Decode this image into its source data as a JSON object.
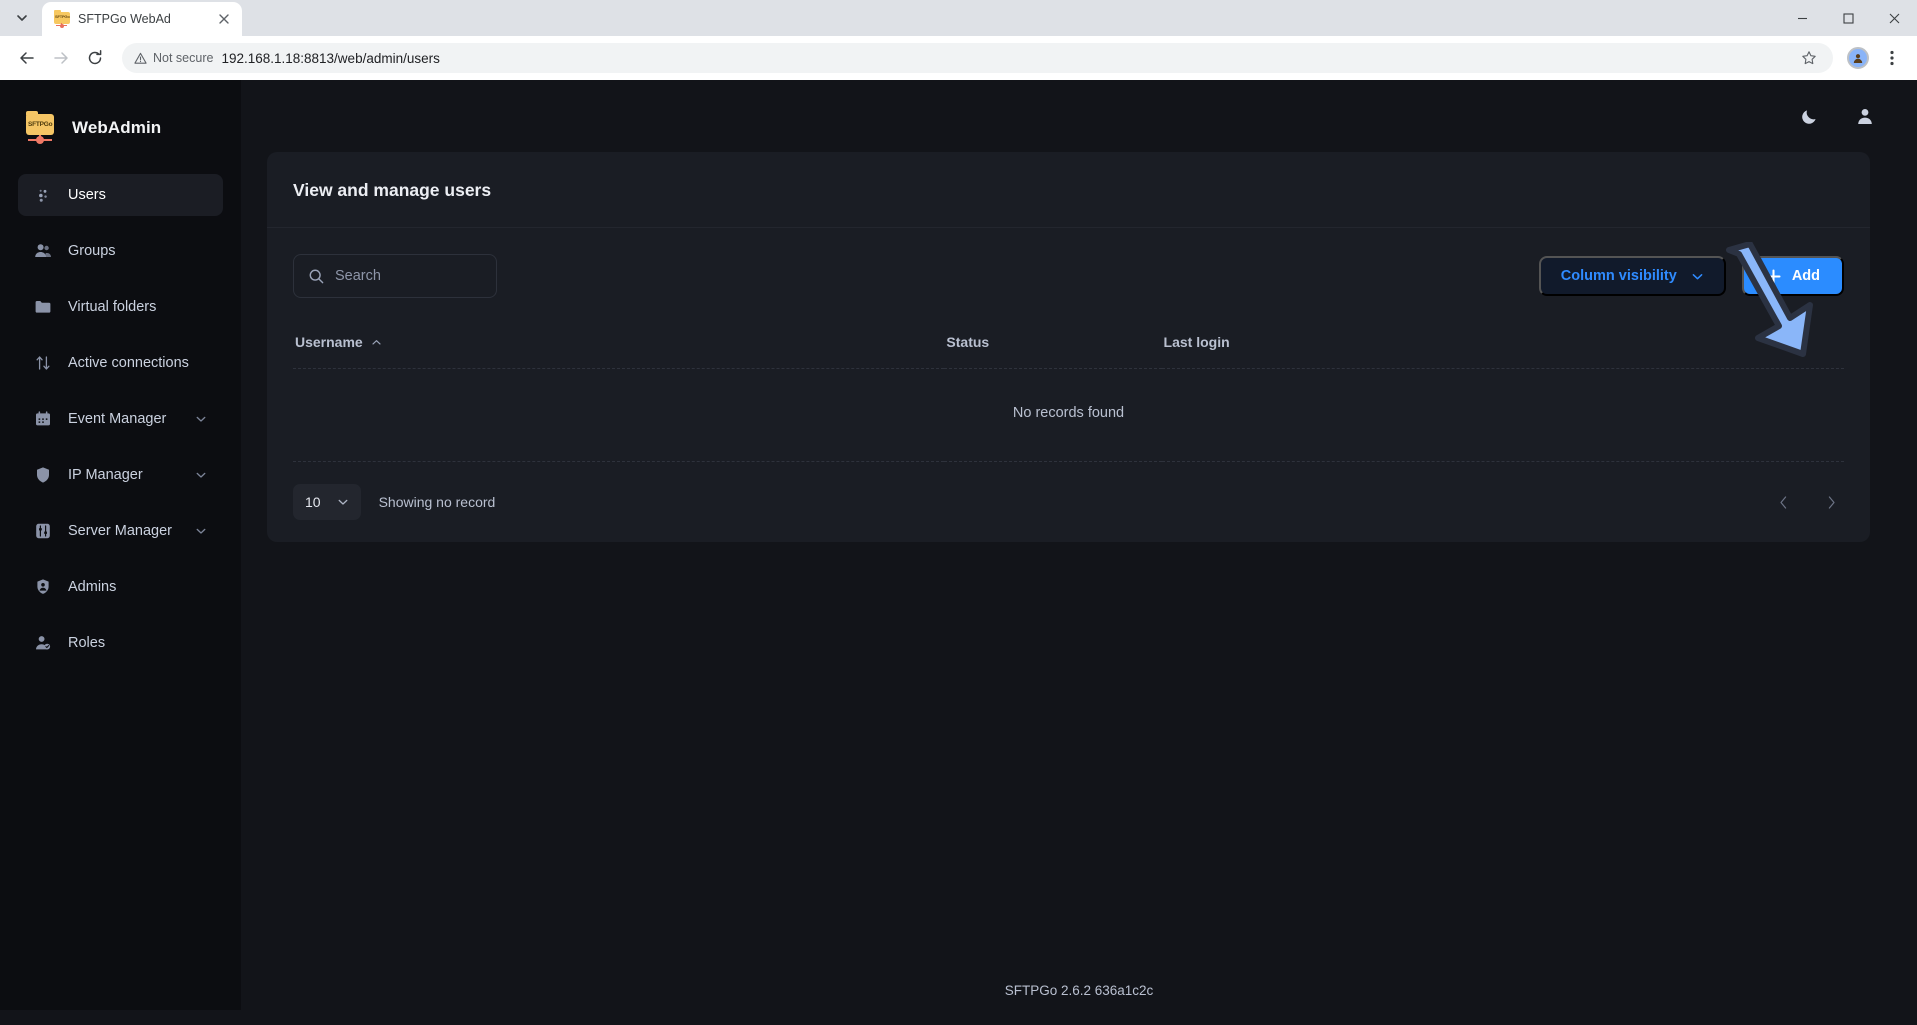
{
  "browser": {
    "tab": {
      "title": "SFTPGo WebAd",
      "favicon_label": "SFTPGo",
      "close_icon": "close-icon"
    },
    "tab_list_icon": "chevron-down-icon",
    "back_icon": "arrow-left-icon",
    "forward_icon": "arrow-right-icon",
    "reload_icon": "reload-icon",
    "security_label": "Not secure",
    "security_icon": "warning-triangle-icon",
    "url": "192.168.1.18:8813/web/admin/users",
    "bookmark_icon": "star-icon",
    "profile_icon": "avatar-icon",
    "menu_icon": "kebab-menu-icon",
    "window_minimize": "—",
    "window_maximize": "❐",
    "window_close": "✕"
  },
  "sidebar": {
    "brand": "WebAdmin",
    "logo_text": "SFTPGo",
    "items": [
      {
        "label": "Users",
        "icon": "users-icon",
        "active": true,
        "expandable": false
      },
      {
        "label": "Groups",
        "icon": "groups-icon",
        "active": false,
        "expandable": false
      },
      {
        "label": "Virtual folders",
        "icon": "folder-icon",
        "active": false,
        "expandable": false
      },
      {
        "label": "Active connections",
        "icon": "transfer-arrows-icon",
        "active": false,
        "expandable": false
      },
      {
        "label": "Event Manager",
        "icon": "calendar-icon",
        "active": false,
        "expandable": true
      },
      {
        "label": "IP Manager",
        "icon": "shield-icon",
        "active": false,
        "expandable": true
      },
      {
        "label": "Server Manager",
        "icon": "sliders-icon",
        "active": false,
        "expandable": true
      },
      {
        "label": "Admins",
        "icon": "admin-shield-icon",
        "active": false,
        "expandable": false
      },
      {
        "label": "Roles",
        "icon": "user-check-icon",
        "active": false,
        "expandable": false
      }
    ]
  },
  "topbar": {
    "theme_toggle_icon": "moon-icon",
    "account_icon": "user-circle-icon"
  },
  "main": {
    "card_title": "View and manage users",
    "search": {
      "placeholder": "Search",
      "value": "",
      "icon": "search-icon"
    },
    "column_visibility_label": "Column visibility",
    "column_visibility_caret": "chevron-down-icon",
    "add_label": "Add",
    "add_plus_icon": "plus-icon",
    "table": {
      "columns": [
        {
          "label": "Username",
          "sorted": true,
          "sort_icon": "chevron-up-icon"
        },
        {
          "label": "Status",
          "sorted": false,
          "sort_icon": ""
        },
        {
          "label": "Last login",
          "sorted": false,
          "sort_icon": ""
        }
      ],
      "rows": [],
      "empty_message": "No records found"
    },
    "pagination": {
      "page_size": "10",
      "page_size_caret": "chevron-down-icon",
      "showing_text": "Showing no record",
      "prev_icon": "chevron-left-icon",
      "next_icon": "chevron-right-icon"
    }
  },
  "footer": {
    "text": "SFTPGo 2.6.2 636a1c2c"
  },
  "annotation": {
    "arrow_icon": "arrow-down-right-annotation",
    "color": "#8ab6f9",
    "outline": "#2b3242"
  },
  "colors": {
    "accent": "#2b8cff",
    "accent_text": "#2f8bff",
    "sidebar_bg": "#0c0d11",
    "page_bg": "#121419",
    "card_bg": "#1a1d24"
  }
}
